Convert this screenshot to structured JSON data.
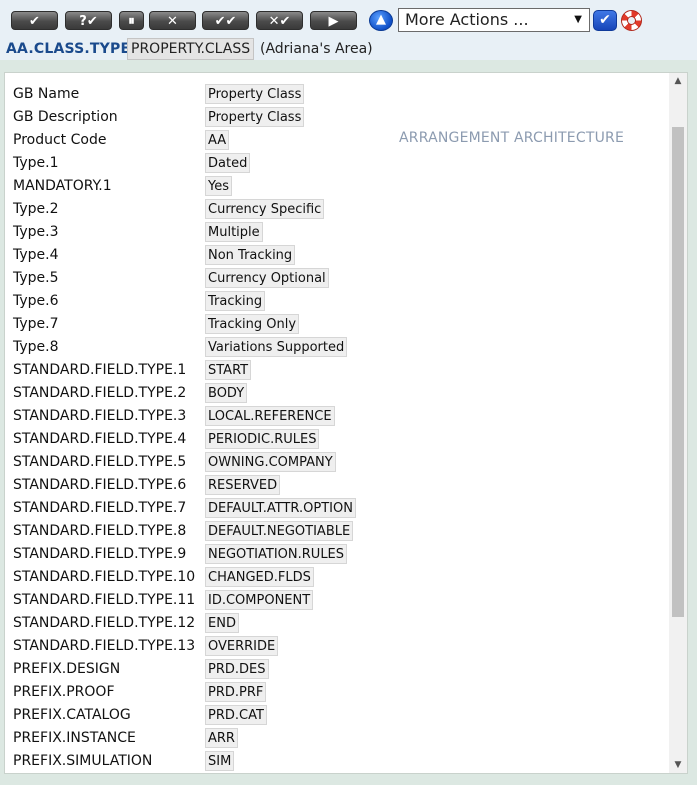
{
  "toolbar": {
    "buttons": [
      {
        "name": "commit-button",
        "glyph": "✔"
      },
      {
        "name": "validate-button",
        "glyph": "?✔"
      },
      {
        "name": "hold-button",
        "glyph": "⏸"
      },
      {
        "name": "delete-button",
        "glyph": "✕"
      },
      {
        "name": "authorise-button",
        "glyph": "✔✔"
      },
      {
        "name": "reverse-button",
        "glyph": "✕✔"
      },
      {
        "name": "next-button",
        "glyph": "▶"
      }
    ],
    "up_icon": "▲",
    "more_actions": "More Actions ...",
    "dropdown_arrow": "▼",
    "go_glyph": "✔"
  },
  "breadcrumb": {
    "app": "AA.CLASS.TYPE",
    "record_id": "PROPERTY.CLASS",
    "description": "(Adriana's Area)"
  },
  "record": {
    "side_note": "ARRANGEMENT ARCHITECTURE",
    "fields": [
      {
        "label": "GB Name",
        "value": "Property Class"
      },
      {
        "label": "GB Description",
        "value": "Property Class"
      },
      {
        "label": "Product Code",
        "value": "AA"
      },
      {
        "label": "Type.1",
        "value": "Dated"
      },
      {
        "label": "MANDATORY.1",
        "value": "Yes"
      },
      {
        "label": "Type.2",
        "value": "Currency Specific"
      },
      {
        "label": "Type.3",
        "value": "Multiple"
      },
      {
        "label": "Type.4",
        "value": "Non Tracking"
      },
      {
        "label": "Type.5",
        "value": "Currency Optional"
      },
      {
        "label": "Type.6",
        "value": "Tracking"
      },
      {
        "label": "Type.7",
        "value": "Tracking Only"
      },
      {
        "label": "Type.8",
        "value": "Variations Supported"
      },
      {
        "label": "STANDARD.FIELD.TYPE.1",
        "value": "START"
      },
      {
        "label": "STANDARD.FIELD.TYPE.2",
        "value": "BODY"
      },
      {
        "label": "STANDARD.FIELD.TYPE.3",
        "value": "LOCAL.REFERENCE"
      },
      {
        "label": "STANDARD.FIELD.TYPE.4",
        "value": "PERIODIC.RULES"
      },
      {
        "label": "STANDARD.FIELD.TYPE.5",
        "value": "OWNING.COMPANY"
      },
      {
        "label": "STANDARD.FIELD.TYPE.6",
        "value": "RESERVED"
      },
      {
        "label": "STANDARD.FIELD.TYPE.7",
        "value": "DEFAULT.ATTR.OPTION"
      },
      {
        "label": "STANDARD.FIELD.TYPE.8",
        "value": "DEFAULT.NEGOTIABLE"
      },
      {
        "label": "STANDARD.FIELD.TYPE.9",
        "value": "NEGOTIATION.RULES"
      },
      {
        "label": "STANDARD.FIELD.TYPE.10",
        "value": "CHANGED.FLDS"
      },
      {
        "label": "STANDARD.FIELD.TYPE.11",
        "value": "ID.COMPONENT"
      },
      {
        "label": "STANDARD.FIELD.TYPE.12",
        "value": "END"
      },
      {
        "label": "STANDARD.FIELD.TYPE.13",
        "value": "OVERRIDE"
      },
      {
        "label": "PREFIX.DESIGN",
        "value": "PRD.DES"
      },
      {
        "label": "PREFIX.PROOF",
        "value": "PRD.PRF"
      },
      {
        "label": "PREFIX.CATALOG",
        "value": "PRD.CAT"
      },
      {
        "label": "PREFIX.INSTANCE",
        "value": "ARR"
      },
      {
        "label": "PREFIX.SIMULATION",
        "value": "SIM"
      }
    ]
  },
  "scrollbar": {
    "up": "▲",
    "down": "▼"
  }
}
